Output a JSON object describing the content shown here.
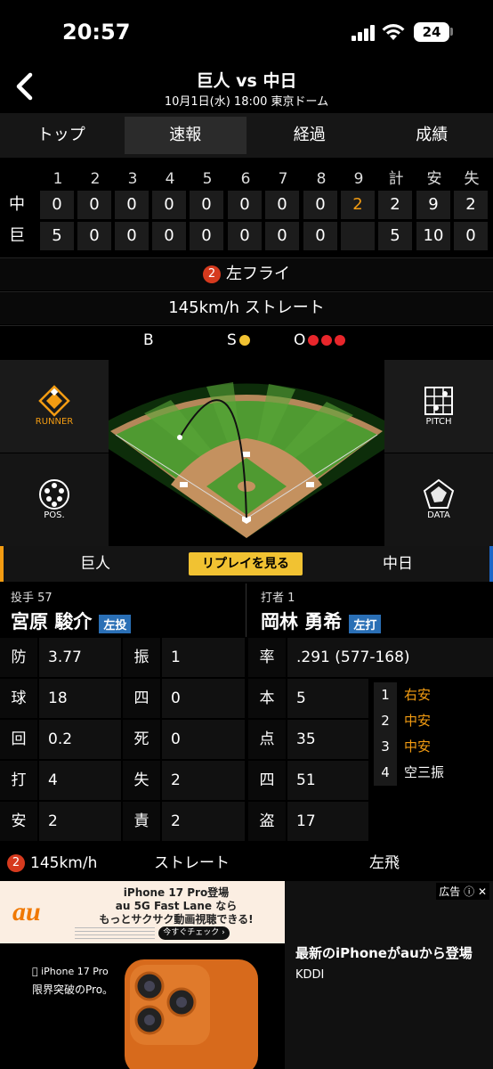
{
  "status_bar": {
    "time": "20:57",
    "battery": "24"
  },
  "header": {
    "title": "巨人 vs 中日",
    "subtitle": "10月1日(水) 18:00 東京ドーム"
  },
  "tabs": [
    {
      "label": "トップ"
    },
    {
      "label": "速報"
    },
    {
      "label": "経過"
    },
    {
      "label": "成績"
    }
  ],
  "scoreboard": {
    "columns": [
      "1",
      "2",
      "3",
      "4",
      "5",
      "6",
      "7",
      "8",
      "9",
      "計",
      "安",
      "失"
    ],
    "rows": [
      {
        "team": "中",
        "cells": [
          "0",
          "0",
          "0",
          "0",
          "0",
          "0",
          "0",
          "0",
          "2",
          "2",
          "9",
          "2"
        ]
      },
      {
        "team": "巨",
        "cells": [
          "5",
          "0",
          "0",
          "0",
          "0",
          "0",
          "0",
          "0",
          "",
          "5",
          "10",
          "0"
        ]
      }
    ]
  },
  "play": {
    "num": "2",
    "result": "左フライ",
    "pitch": "145km/h ストレート"
  },
  "count": {
    "b_label": "B",
    "s_label": "S",
    "o_label": "O"
  },
  "field_panels": {
    "runner": "RUNNER",
    "pitch": "PITCH",
    "pos": "POS.",
    "data": "DATA"
  },
  "team_tabs": {
    "left": "巨人",
    "replay": "リプレイを見る",
    "right": "中日"
  },
  "pitcher": {
    "role": "投手 57",
    "name": "宮原 駿介",
    "hand": "左投",
    "stats": [
      {
        "label": "防",
        "value": "3.77"
      },
      {
        "label": "球",
        "value": "18"
      },
      {
        "label": "回",
        "value": "0.2"
      },
      {
        "label": "打",
        "value": "4"
      },
      {
        "label": "安",
        "value": "2"
      }
    ],
    "stats2": [
      {
        "label": "振",
        "value": "1"
      },
      {
        "label": "四",
        "value": "0"
      },
      {
        "label": "死",
        "value": "0"
      },
      {
        "label": "失",
        "value": "2"
      },
      {
        "label": "責",
        "value": "2"
      }
    ]
  },
  "batter": {
    "role": "打者 1",
    "name": "岡林 勇希",
    "hand": "左打",
    "stats": [
      {
        "label": "率",
        "value": ".291 (577-168)"
      },
      {
        "label": "本",
        "value": "5"
      },
      {
        "label": "点",
        "value": "35"
      },
      {
        "label": "四",
        "value": "51"
      },
      {
        "label": "盗",
        "value": "17"
      }
    ],
    "at_bats": [
      {
        "num": "1",
        "result": "右安",
        "color": "#f39c12"
      },
      {
        "num": "2",
        "result": "中安",
        "color": "#f39c12"
      },
      {
        "num": "3",
        "result": "中安",
        "color": "#f39c12"
      },
      {
        "num": "4",
        "result": "空三振",
        "color": "#ffffff"
      }
    ]
  },
  "bottom_play": {
    "num": "2",
    "speed": "145km/h",
    "pitch": "ストレート",
    "result": "左飛"
  },
  "ad": {
    "brand": "au",
    "headline1": "iPhone 17 Pro登場",
    "headline2": "au 5G Fast Lane なら",
    "headline3": "もっとサクサク動画視聴できる!",
    "cta": "今すぐチェック ›",
    "product": "iPhone 17 Pro",
    "tagline": "限界突破のPro。",
    "label": "広告",
    "right_title": "最新のiPhoneがauから登場",
    "right_sub": "KDDI"
  }
}
